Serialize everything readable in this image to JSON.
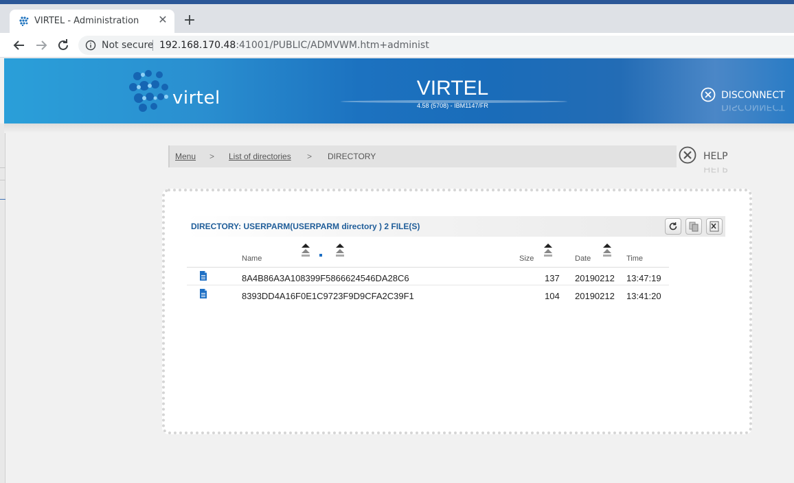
{
  "browser": {
    "tab_title": "VIRTEL - Administration",
    "tab_close": "✕",
    "new_tab": "+",
    "not_secure": "Not secure",
    "url_host": "192.168.170.48",
    "url_rest": ":41001/PUBLIC/ADMVWM.htm+administ"
  },
  "header": {
    "logo_text": "virtel",
    "title": "VIRTEL",
    "version": "4.58 (5708) - IBM1147/FR",
    "disconnect_label": "DISCONNECT"
  },
  "breadcrumb": {
    "menu": "Menu",
    "sep1": ">",
    "list": "List of directories",
    "sep2": ">",
    "current": "DIRECTORY"
  },
  "help_label": "HELP",
  "directory": {
    "title": "DIRECTORY: USERPARM(USERPARM directory ) 2 FILE(S)",
    "columns": {
      "name": "Name",
      "size": "Size",
      "date": "Date",
      "time": "Time"
    },
    "files": [
      {
        "name": "8A4B86A3A108399F5866624546DA28C6",
        "size": "137",
        "date": "20190212",
        "time": "13:47:19"
      },
      {
        "name": "8393DD4A16F0E1C9723F9D9CFA2C39F1",
        "size": "104",
        "date": "20190212",
        "time": "13:41:20"
      }
    ]
  },
  "icons": {
    "favicon": "virtel-favicon-icon",
    "back": "back-arrow-icon",
    "forward": "forward-arrow-icon",
    "reload": "reload-icon",
    "info": "info-icon",
    "disconnect": "close-circle-icon",
    "help": "tools-icon",
    "refresh": "refresh-icon",
    "copy": "copy-icon",
    "export": "excel-export-icon",
    "file": "file-icon",
    "sort": "sort-arrows-icon"
  },
  "colors": {
    "brand_blue": "#1a6cb9",
    "title_blue": "#1f5d99",
    "file_icon": "#1e6fc4"
  }
}
